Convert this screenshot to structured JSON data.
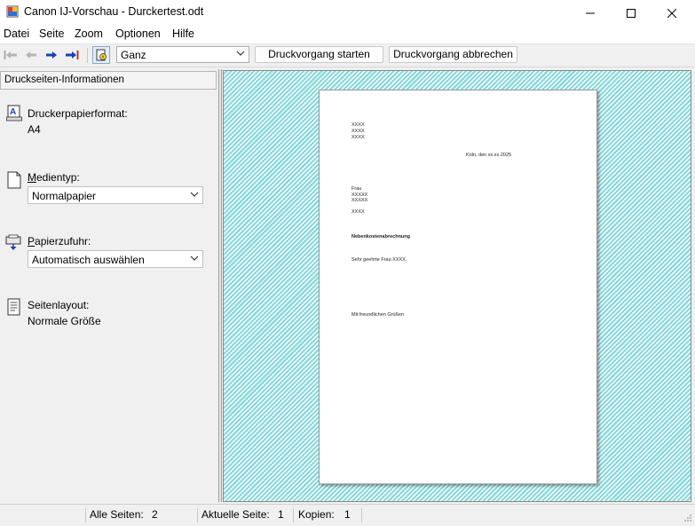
{
  "window": {
    "title": "Canon IJ-Vorschau - Durckertest.odt"
  },
  "menu": {
    "items": [
      "Datei",
      "Seite",
      "Zoom",
      "Optionen",
      "Hilfe"
    ]
  },
  "toolbar": {
    "zoom_value": "Ganz",
    "start_label": "Druckvorgang starten",
    "cancel_label": "Druckvorgang abbrechen"
  },
  "panel": {
    "title": "Druckseiten-Informationen",
    "paper_format": {
      "label": "Druckerpapierformat:",
      "value": "A4"
    },
    "media_type": {
      "label_first": "M",
      "label_rest": "edientyp:",
      "value": "Normalpapier"
    },
    "paper_source": {
      "label_first": "P",
      "label_rest": "apierzufuhr:",
      "value": "Automatisch auswählen"
    },
    "layout": {
      "label": "Seitenlayout:",
      "value": "Normale Größe"
    }
  },
  "document": {
    "sender": [
      "XXXX",
      "XXXX",
      "XXXX"
    ],
    "date": "Köln, den xx.xx.2025",
    "recipient": [
      "Frau",
      "XXXXX",
      "XXXXX"
    ],
    "recipient_city": "XXXX",
    "subject": "Nebenkostenabrechnung",
    "salutation": "Sehr geehrte Frau XXXX,",
    "closing": "Mit freundlichen Grüßen"
  },
  "status": {
    "all_pages_label": "Alle Seiten:",
    "all_pages_value": "2",
    "current_page_label": "Aktuelle Seite:",
    "current_page_value": "1",
    "copies_label": "Kopien:",
    "copies_value": "1"
  }
}
